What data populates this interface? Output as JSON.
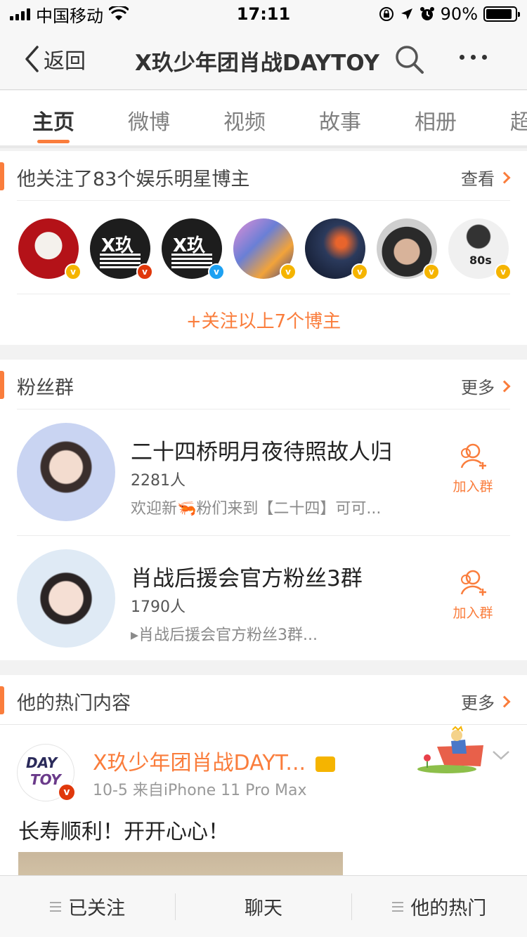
{
  "status_bar": {
    "carrier": "中国移动",
    "time": "17:11",
    "battery": "90%"
  },
  "nav": {
    "back_label": "返回",
    "title": "X玖少年团肖战DAYTOY"
  },
  "tabs": [
    {
      "label": "主页"
    },
    {
      "label": "微博"
    },
    {
      "label": "视频"
    },
    {
      "label": "故事"
    },
    {
      "label": "相册"
    },
    {
      "label": "超"
    }
  ],
  "following": {
    "title": "他关注了83个娱乐明星博主",
    "more_label": "查看",
    "follow_all_label": "+关注以上7个博主"
  },
  "fan_groups": {
    "title": "粉丝群",
    "more_label": "更多",
    "groups": [
      {
        "name": "二十四桥明月夜待照故人归",
        "count": "2281人",
        "message": "欢迎新🦐粉们来到【二十四】可可...",
        "join_label": "加入群"
      },
      {
        "name": "肖战后援会官方粉丝3群",
        "count": "1790人",
        "message": "▸肖战后援会官方粉丝3群...",
        "join_label": "加入群"
      }
    ]
  },
  "hot": {
    "title": "他的热门内容",
    "more_label": "更多",
    "post": {
      "author": "X玖少年团肖战DAYT...",
      "meta": "10-5  来自iPhone 11 Pro Max",
      "text": "长寿顺利！开开心心！",
      "logo_line1": "DAY",
      "logo_line2": "TOY"
    }
  },
  "bottom_bar": {
    "followed_label": "已关注",
    "chat_label": "聊天",
    "hot_label": "他的热门"
  },
  "colors": {
    "accent": "#fa7d3c",
    "verified_gold": "#f5b400",
    "verified_red": "#e0380b",
    "verified_blue": "#1da1f2"
  }
}
